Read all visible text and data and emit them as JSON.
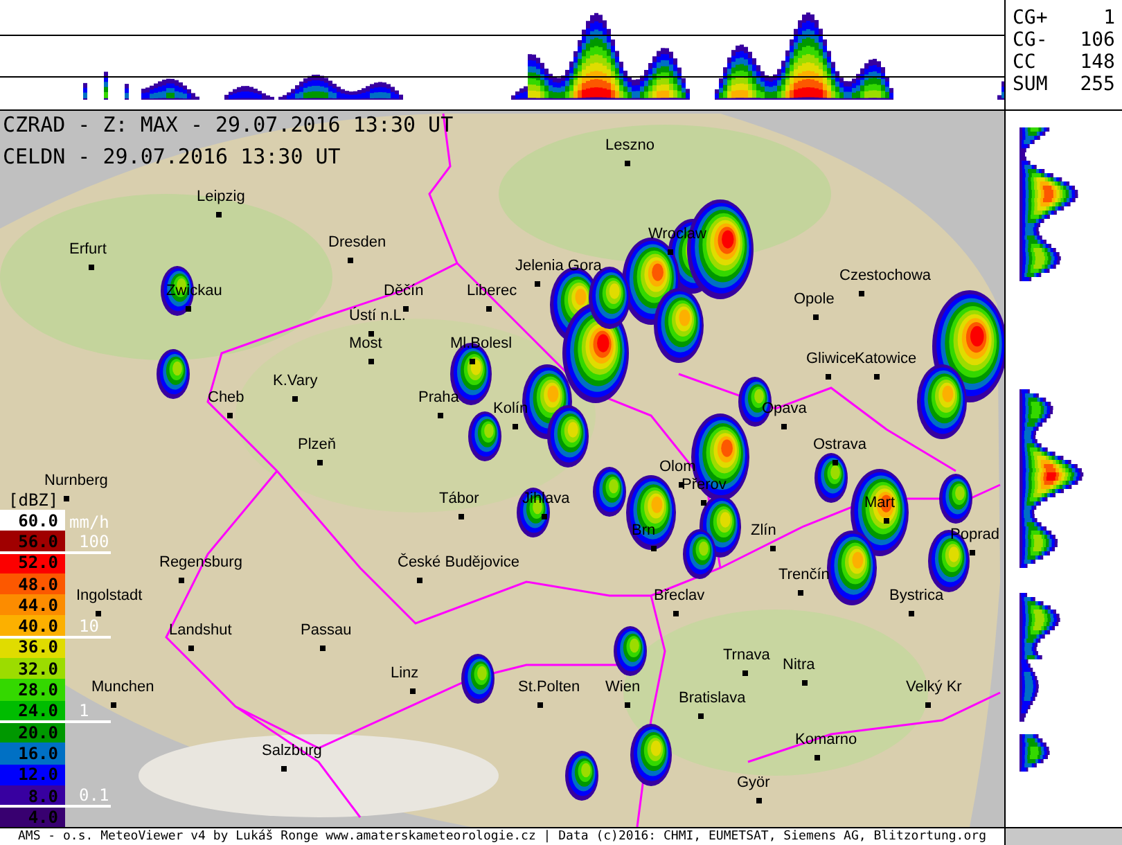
{
  "header": {
    "lines": [
      "CZRAD - Z: MAX - 29.07.2016 13:30 UT",
      "CELDN - 29.07.2016 13:30 UT"
    ]
  },
  "lightning_stats": [
    {
      "label": "CG+",
      "value": "1"
    },
    {
      "label": "CG-",
      "value": "106"
    },
    {
      "label": "CC",
      "value": "148"
    },
    {
      "label": "SUM",
      "value": "255"
    }
  ],
  "cities": [
    "Leszno",
    "Leipzig",
    "Wroclaw",
    "Dresden",
    "Erfurt",
    "Jelenia Gora",
    "Czestochowa",
    "Zwickau",
    "Děčín",
    "Liberec",
    "Opole",
    "Ústí n.L.",
    "Most",
    "Ml.Bolesl",
    "Gliwice",
    "Katowice",
    "K.Vary",
    "Cheb",
    "Praha",
    "Kolín",
    "Opava",
    "Plzeň",
    "Ostrava",
    "Olom",
    "Nurnberg",
    "Přerov",
    "Tábor",
    "Jihlava",
    "Mart",
    "Brn",
    "Zlín",
    "Poprad",
    "Regensburg",
    "České Budějovice",
    "Trenčín",
    "Ingolstadt",
    "Břeclav",
    "Bystrica",
    "Landshut",
    "Passau",
    "Trnava",
    "Nitra",
    "Linz",
    "Munchen",
    "St.Polten",
    "Wien",
    "Velký Kr",
    "Bratislava",
    "Komarno",
    "Salzburg",
    "Györ"
  ],
  "legend": {
    "unit": "[dBZ]",
    "rate_unit": "mm/h",
    "levels": [
      {
        "label": "60.0",
        "color": "#ffffff"
      },
      {
        "label": "56.0",
        "color": "#a00000"
      },
      {
        "label": "52.0",
        "color": "#fc0000"
      },
      {
        "label": "48.0",
        "color": "#fc5800"
      },
      {
        "label": "44.0",
        "color": "#fc8c00"
      },
      {
        "label": "40.0",
        "color": "#fcb000"
      },
      {
        "label": "36.0",
        "color": "#e0dc00"
      },
      {
        "label": "32.0",
        "color": "#9cdc00"
      },
      {
        "label": "28.0",
        "color": "#34d800"
      },
      {
        "label": "24.0",
        "color": "#00bc00"
      },
      {
        "label": "20.0",
        "color": "#009800"
      },
      {
        "label": "16.0",
        "color": "#0070c4"
      },
      {
        "label": "12.0",
        "color": "#0000fc"
      },
      {
        "label": "8.0",
        "color": "#3800a0"
      },
      {
        "label": "4.0",
        "color": "#380070"
      }
    ],
    "rate_marks": [
      "100",
      "10",
      "1",
      "0.1"
    ]
  },
  "footer": "AMS - o.s. MeteoViewer v4 by Lukáš Ronge www.amaterskameteorologie.cz | Data (c)2016: CHMI, EUMETSAT, Siemens AG, Blitzortung.org"
}
